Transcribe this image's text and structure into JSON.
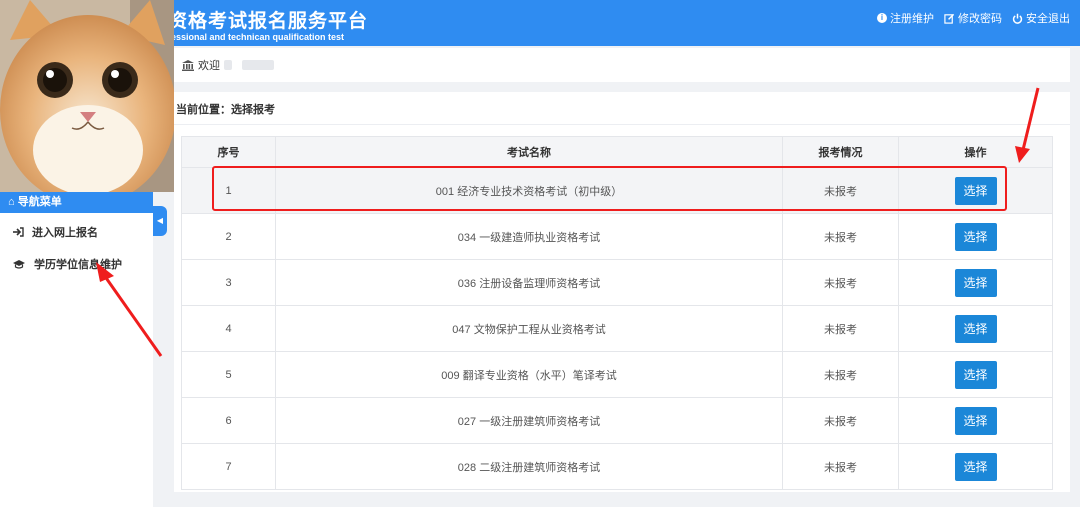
{
  "header": {
    "title": "资格考试报名服务平台",
    "subtitle": "fessional and technican qualification test",
    "links": [
      {
        "icon": "info-icon",
        "label": "注册维护"
      },
      {
        "icon": "edit-icon",
        "label": "修改密码"
      },
      {
        "icon": "power-icon",
        "label": "安全退出"
      }
    ]
  },
  "sidebar": {
    "nav_header": "导航菜单",
    "items": [
      {
        "icon": "sign-in-icon",
        "label": "进入网上报名"
      },
      {
        "icon": "graduation-cap-icon",
        "label": "学历学位信息维护"
      }
    ]
  },
  "welcome": {
    "text": "欢迎"
  },
  "breadcrumb": {
    "text": "当前位置：选择报考"
  },
  "table": {
    "headers": [
      "序号",
      "考试名称",
      "报考情况",
      "操作"
    ],
    "rows": [
      {
        "index": "1",
        "name": "001 经济专业技术资格考试（初中级）",
        "status": "未报考",
        "action": "选择"
      },
      {
        "index": "2",
        "name": "034 一级建造师执业资格考试",
        "status": "未报考",
        "action": "选择"
      },
      {
        "index": "3",
        "name": "036 注册设备监理师资格考试",
        "status": "未报考",
        "action": "选择"
      },
      {
        "index": "4",
        "name": "047 文物保护工程从业资格考试",
        "status": "未报考",
        "action": "选择"
      },
      {
        "index": "5",
        "name": "009 翻译专业资格（水平）笔译考试",
        "status": "未报考",
        "action": "选择"
      },
      {
        "index": "6",
        "name": "027 一级注册建筑师资格考试",
        "status": "未报考",
        "action": "选择"
      },
      {
        "index": "7",
        "name": "028 二级注册建筑师资格考试",
        "status": "未报考",
        "action": "选择"
      }
    ]
  },
  "colors": {
    "primary": "#2f8cf1",
    "button": "#1b87d8",
    "annotation": "#ef1d1d"
  }
}
